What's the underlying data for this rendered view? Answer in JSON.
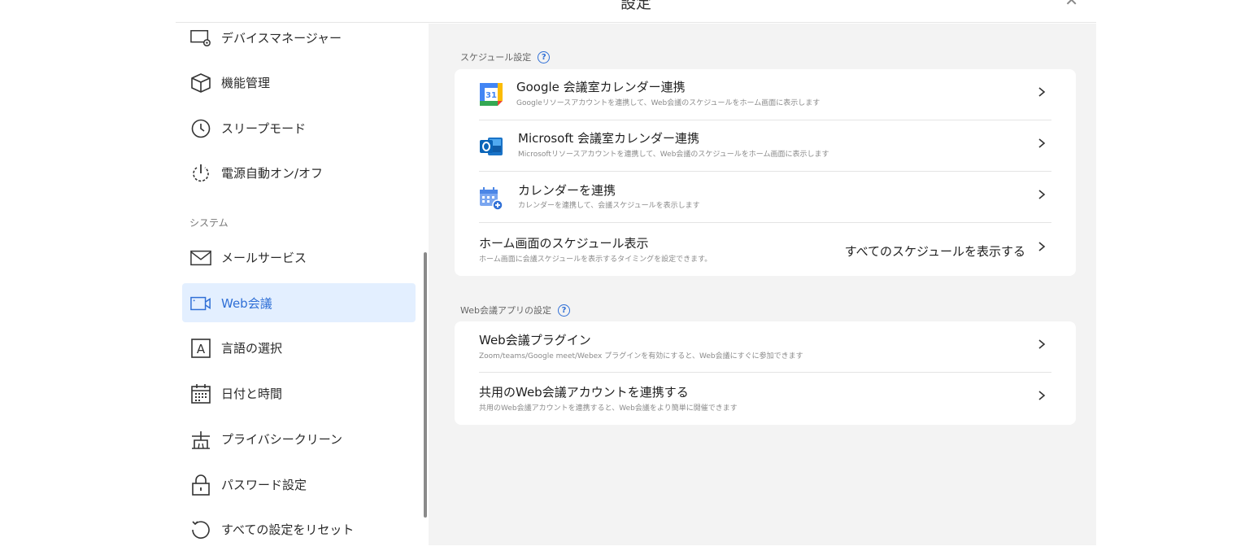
{
  "window": {
    "title": "設定",
    "close_icon": "close-icon"
  },
  "sidebar": {
    "items": [
      {
        "label": "デバイスマネージャー",
        "icon": "device-manager-icon"
      },
      {
        "label": "機能管理",
        "icon": "cube-icon"
      },
      {
        "label": "スリープモード",
        "icon": "clock-icon"
      },
      {
        "label": "電源自動オン/オフ",
        "icon": "power-icon"
      },
      {
        "label": "メールサービス",
        "icon": "mail-icon"
      },
      {
        "label": "Web会議",
        "icon": "video-camera-icon",
        "active": true
      },
      {
        "label": "言語の選択",
        "icon": "language-icon"
      },
      {
        "label": "日付と時間",
        "icon": "calendar-icon"
      },
      {
        "label": "プライバシークリーン",
        "icon": "privacy-icon"
      },
      {
        "label": "パスワード設定",
        "icon": "lock-icon"
      },
      {
        "label": "すべての設定をリセット",
        "icon": "reset-icon"
      }
    ],
    "section_system": "システム"
  },
  "schedule": {
    "label": "スケジュール設定",
    "rows": [
      {
        "title": "Google 会議室カレンダー連携",
        "subtitle": "Googleリソースアカウントを連携して、Web会議のスケジュールをホーム画面に表示します",
        "icon": "google-calendar-icon"
      },
      {
        "title": "Microsoft 会議室カレンダー連携",
        "subtitle": "Microsoftリソースアカウントを連携して、Web会議のスケジュールをホーム画面に表示します",
        "icon": "outlook-icon"
      },
      {
        "title": "カレンダーを連携",
        "subtitle": "カレンダーを連携して、会議スケジュールを表示します",
        "icon": "calendar-add-icon"
      },
      {
        "title": "ホーム画面のスケジュール表示",
        "subtitle": "ホーム画面に会議スケジュールを表示するタイミングを設定できます。",
        "value": "すべてのスケジュールを表示する"
      }
    ]
  },
  "webconf": {
    "label": "Web会議アプリの設定",
    "rows": [
      {
        "title": "Web会議プラグイン",
        "subtitle": "Zoom/teams/Google meet/Webex プラグインを有効にすると、Web会議にすぐに参加できます"
      },
      {
        "title": "共用のWeb会議アカウントを連携する",
        "subtitle": "共用のWeb会議アカウントを連携すると、Web会議をより簡単に開催できます"
      }
    ]
  },
  "colors": {
    "accent": "#2f6fd6",
    "active_bg": "#e3efff",
    "panel_bg": "#f3f3f3"
  }
}
